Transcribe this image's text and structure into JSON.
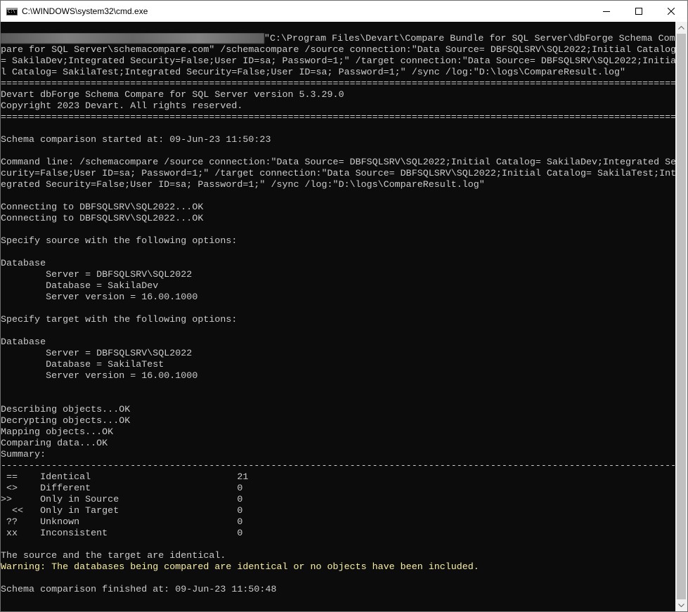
{
  "window": {
    "title": "C:\\WINDOWS\\system32\\cmd.exe",
    "icon": "cmd-icon",
    "controls": [
      "minimize-icon",
      "maximize-icon",
      "close-icon"
    ]
  },
  "console": {
    "lines": [
      {
        "text": "\"C:\\Program Files\\Devart\\Compare Bundle for SQL Server\\dbForge Schema Com",
        "redacted": true
      },
      {
        "text": "pare for SQL Server\\schemacompare.com\" /schemacompare /source connection:\"Data Source= DBFSQLSRV\\SQL2022;Initial Catalog"
      },
      {
        "text": "= SakilaDev;Integrated Security=False;User ID=sa; Password=1;\" /target connection:\"Data Source= DBFSQLSRV\\SQL2022;Initia"
      },
      {
        "text": "l Catalog= SakilaTest;Integrated Security=False;User ID=sa; Password=1;\" /sync /log:\"D:\\logs\\CompareResult.log\""
      },
      {
        "text": "==============================================================================================================================="
      },
      {
        "text": "Devart dbForge Schema Compare for SQL Server version 5.3.29.0"
      },
      {
        "text": "Copyright 2023 Devart. All rights reserved."
      },
      {
        "text": "==============================================================================================================================="
      },
      {
        "text": ""
      },
      {
        "text": "Schema comparison started at: 09-Jun-23 11:50:23"
      },
      {
        "text": ""
      },
      {
        "text": "Command line: /schemacompare /source connection:\"Data Source= DBFSQLSRV\\SQL2022;Initial Catalog= SakilaDev;Integrated Se"
      },
      {
        "text": "curity=False;User ID=sa; Password=1;\" /target connection:\"Data Source= DBFSQLSRV\\SQL2022;Initial Catalog= SakilaTest;Int"
      },
      {
        "text": "egrated Security=False;User ID=sa; Password=1;\" /sync /log:\"D:\\logs\\CompareResult.log\""
      },
      {
        "text": ""
      },
      {
        "text": "Connecting to DBFSQLSRV\\SQL2022...OK"
      },
      {
        "text": "Connecting to DBFSQLSRV\\SQL2022...OK"
      },
      {
        "text": ""
      },
      {
        "text": "Specify source with the following options:"
      },
      {
        "text": ""
      },
      {
        "text": "Database"
      },
      {
        "text": "        Server = DBFSQLSRV\\SQL2022"
      },
      {
        "text": "        Database = SakilaDev"
      },
      {
        "text": "        Server version = 16.00.1000"
      },
      {
        "text": ""
      },
      {
        "text": "Specify target with the following options:"
      },
      {
        "text": ""
      },
      {
        "text": "Database"
      },
      {
        "text": "        Server = DBFSQLSRV\\SQL2022"
      },
      {
        "text": "        Database = SakilaTest"
      },
      {
        "text": "        Server version = 16.00.1000"
      },
      {
        "text": ""
      },
      {
        "text": ""
      },
      {
        "text": "Describing objects...OK"
      },
      {
        "text": "Decrypting objects...OK"
      },
      {
        "text": "Mapping objects...OK"
      },
      {
        "text": "Comparing data...OK"
      },
      {
        "text": "Summary:"
      },
      {
        "text": "-------------------------------------------------------------------------------------------------------------------------------"
      },
      {
        "text": " ==    Identical                          21"
      },
      {
        "text": " <>    Different                          0"
      },
      {
        "text": ">>     Only in Source                     0"
      },
      {
        "text": "  <<   Only in Target                     0"
      },
      {
        "text": " ??    Unknown                            0"
      },
      {
        "text": " xx    Inconsistent                       0"
      },
      {
        "text": ""
      },
      {
        "text": "The source and the target are identical."
      },
      {
        "text": "Warning: The databases being compared are identical or no objects have been included.",
        "warning": true
      },
      {
        "text": ""
      },
      {
        "text": "Schema comparison finished at: 09-Jun-23 11:50:48"
      }
    ]
  },
  "colors": {
    "background": "#0c0c0c",
    "text": "#cccccc",
    "warning": "#f9f1a5"
  }
}
